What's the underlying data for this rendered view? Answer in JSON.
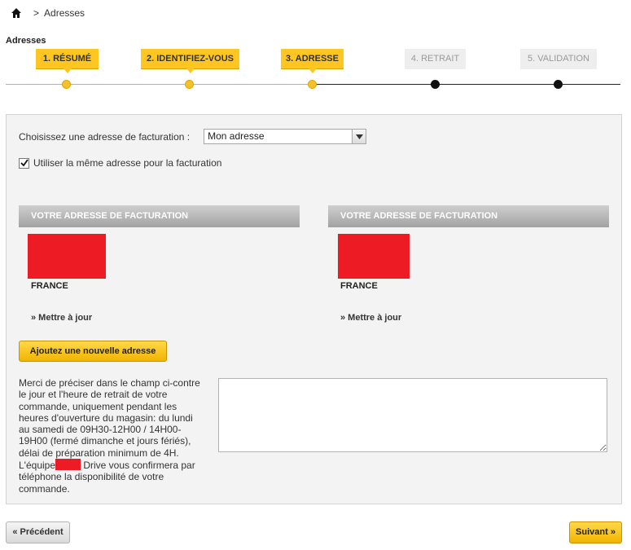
{
  "breadcrumb": {
    "home_icon": "home-icon",
    "separator": ">",
    "current": "Adresses"
  },
  "page": {
    "title": "Adresses"
  },
  "steps": [
    {
      "label": "1. RÉSUMÉ",
      "state": "done"
    },
    {
      "label": "2. IDENTIFIEZ-VOUS",
      "state": "done"
    },
    {
      "label": "3. ADRESSE",
      "state": "done"
    },
    {
      "label": "4. RETRAIT",
      "state": "todo"
    },
    {
      "label": "5. VALIDATION",
      "state": "todo"
    }
  ],
  "colors": {
    "accent": "#ffc622",
    "redacted": "#ed1c24",
    "panel_bg": "#f3f3f3",
    "header_grey": "#a2a2a2"
  },
  "billing": {
    "label": "Choisissez une adresse de facturation :",
    "selected": "Mon adresse"
  },
  "same_address": {
    "checked": true,
    "label": "Utiliser la même adresse pour la facturation"
  },
  "addresses": [
    {
      "header": "VOTRE ADRESSE DE FACTURATION",
      "country": "FRANCE",
      "update_link": "» Mettre à jour"
    },
    {
      "header": "VOTRE ADRESSE DE FACTURATION",
      "country": "FRANCE",
      "update_link": "» Mettre à jour"
    }
  ],
  "add_address_button": "Ajoutez une nouvelle adresse",
  "note": {
    "before": "Merci de préciser dans le champ ci-contre le jour et l'heure de retrait de votre commande, uniquement pendant les heures d'ouverture du magasin: du lundi au samedi de 09H30-12H00 / 14H00-19H00 (fermé dimanche et jours fériés), délai de préparation minimum de 4H. L'équipe",
    "after": "Drive vous confirmera par téléphone la disponibilité de votre commande."
  },
  "comment": {
    "value": ""
  },
  "nav": {
    "prev": "« Précédent",
    "next": "Suivant »"
  }
}
